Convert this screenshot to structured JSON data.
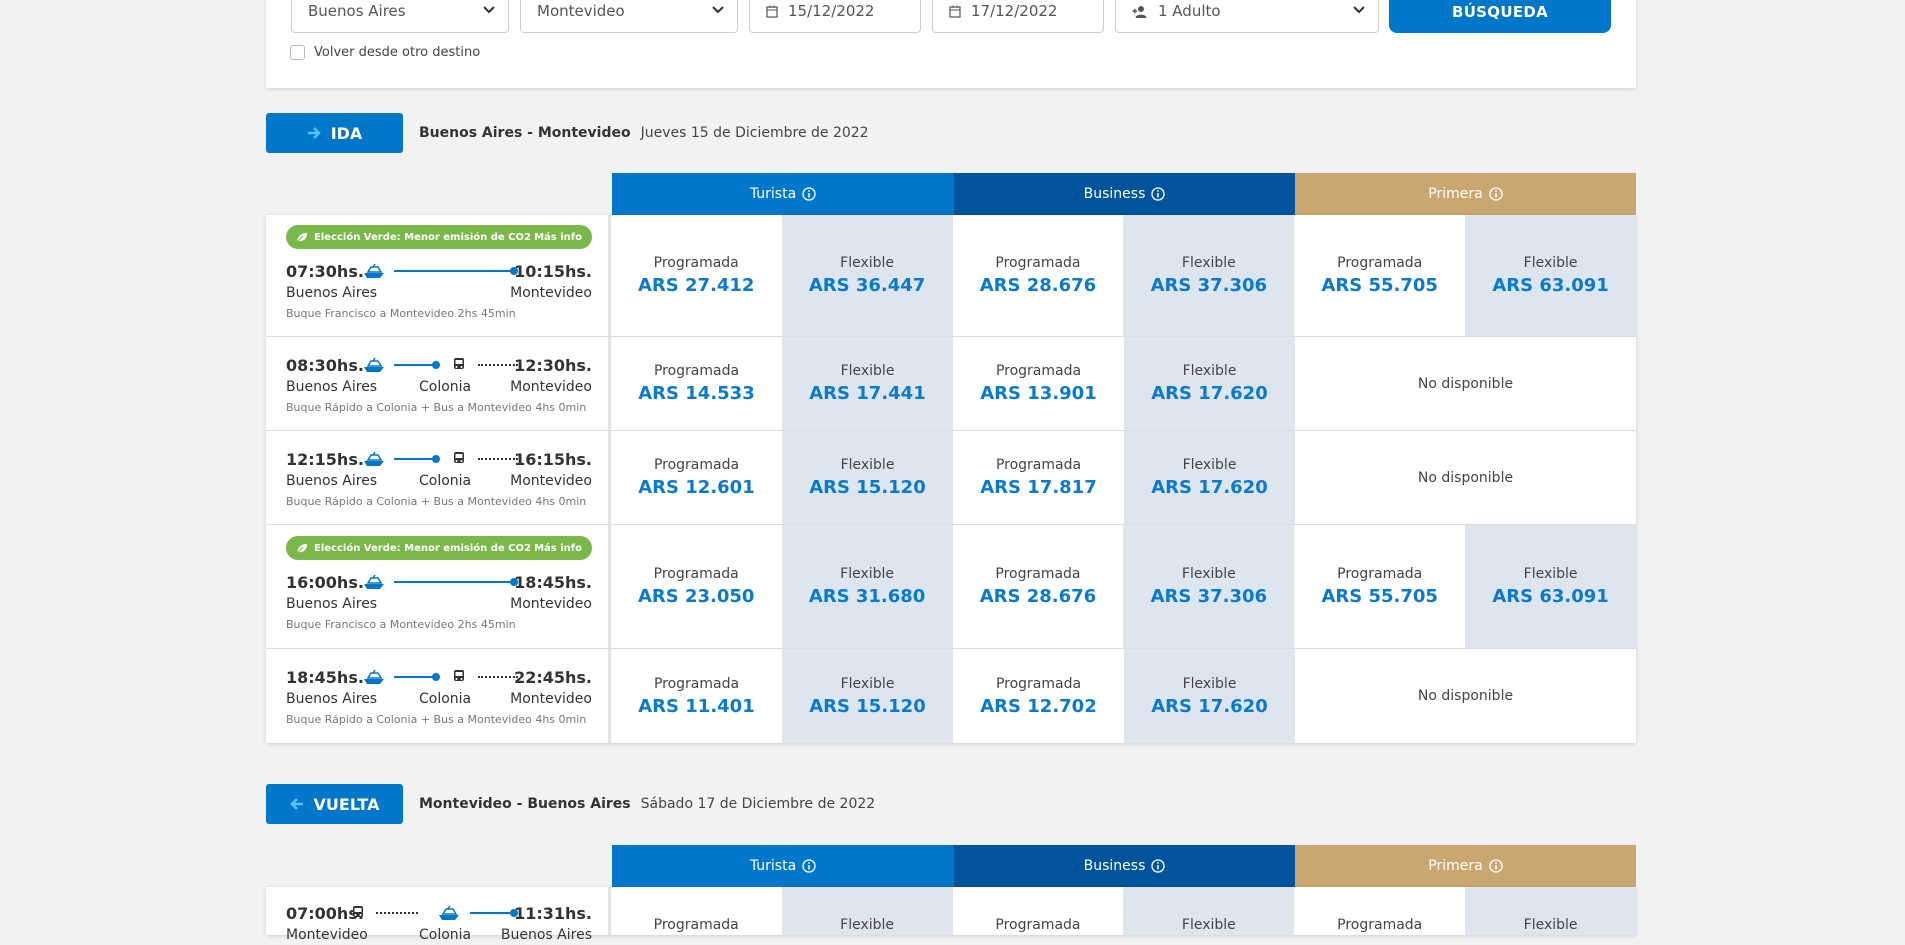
{
  "search": {
    "origin": "Buenos Aires",
    "destination": "Montevideo",
    "date_out": "15/12/2022",
    "date_back": "17/12/2022",
    "passengers": "1 Adulto",
    "button": "BÚSQUEDA",
    "other_dest": "Volver desde otro destino"
  },
  "classes": {
    "turista": "Turista",
    "business": "Business",
    "primera": "Primera"
  },
  "labels": {
    "programada": "Programada",
    "flexible": "Flexible",
    "no_disp": "No disponible"
  },
  "green": {
    "text": "Elección Verde: Menor emisión de CO2",
    "more": "Más info"
  },
  "ida": {
    "label": "IDA",
    "route": "Buenos Aires - Montevideo",
    "date": "Jueves 15 de Diciembre de 2022",
    "trips": [
      {
        "dep": "07:30hs.",
        "arr": "10:15hs.",
        "from": "Buenos Aires",
        "via": "",
        "to": "Montevideo",
        "desc": "Buque Francisco a Montevideo 2hs 45min",
        "green": true,
        "tur_p": "ARS 27.412",
        "tur_f": "ARS 36.447",
        "bus_p": "ARS 28.676",
        "bus_f": "ARS 37.306",
        "pri_p": "ARS 55.705",
        "pri_f": "ARS 63.091"
      },
      {
        "dep": "08:30hs.",
        "arr": "12:30hs.",
        "from": "Buenos Aires",
        "via": "Colonia",
        "to": "Montevideo",
        "desc": "Buque Rápido a Colonia + Bus a Montevideo 4hs 0min",
        "green": false,
        "tur_p": "ARS 14.533",
        "tur_f": "ARS 17.441",
        "bus_p": "ARS 13.901",
        "bus_f": "ARS 17.620"
      },
      {
        "dep": "12:15hs.",
        "arr": "16:15hs.",
        "from": "Buenos Aires",
        "via": "Colonia",
        "to": "Montevideo",
        "desc": "Buque Rápido a Colonia + Bus a Montevideo 4hs 0min",
        "green": false,
        "tur_p": "ARS 12.601",
        "tur_f": "ARS 15.120",
        "bus_p": "ARS 17.817",
        "bus_f": "ARS 17.620"
      },
      {
        "dep": "16:00hs.",
        "arr": "18:45hs.",
        "from": "Buenos Aires",
        "via": "",
        "to": "Montevideo",
        "desc": "Buque Francisco a Montevideo 2hs 45min",
        "green": true,
        "tur_p": "ARS 23.050",
        "tur_f": "ARS 31.680",
        "bus_p": "ARS 28.676",
        "bus_f": "ARS 37.306",
        "pri_p": "ARS 55.705",
        "pri_f": "ARS 63.091"
      },
      {
        "dep": "18:45hs.",
        "arr": "22:45hs.",
        "from": "Buenos Aires",
        "via": "Colonia",
        "to": "Montevideo",
        "desc": "Buque Rápido a Colonia + Bus a Montevideo 4hs 0min",
        "green": false,
        "tur_p": "ARS 11.401",
        "tur_f": "ARS 15.120",
        "bus_p": "ARS 12.702",
        "bus_f": "ARS 17.620"
      }
    ]
  },
  "vuelta": {
    "label": "VUELTA",
    "route": "Montevideo - Buenos Aires",
    "date": "Sábado 17 de Diciembre de 2022",
    "trips": [
      {
        "dep": "07:00hs.",
        "arr": "11:31hs.",
        "from": "Montevideo",
        "via": "Colonia",
        "to": "Buenos Aires"
      }
    ]
  }
}
